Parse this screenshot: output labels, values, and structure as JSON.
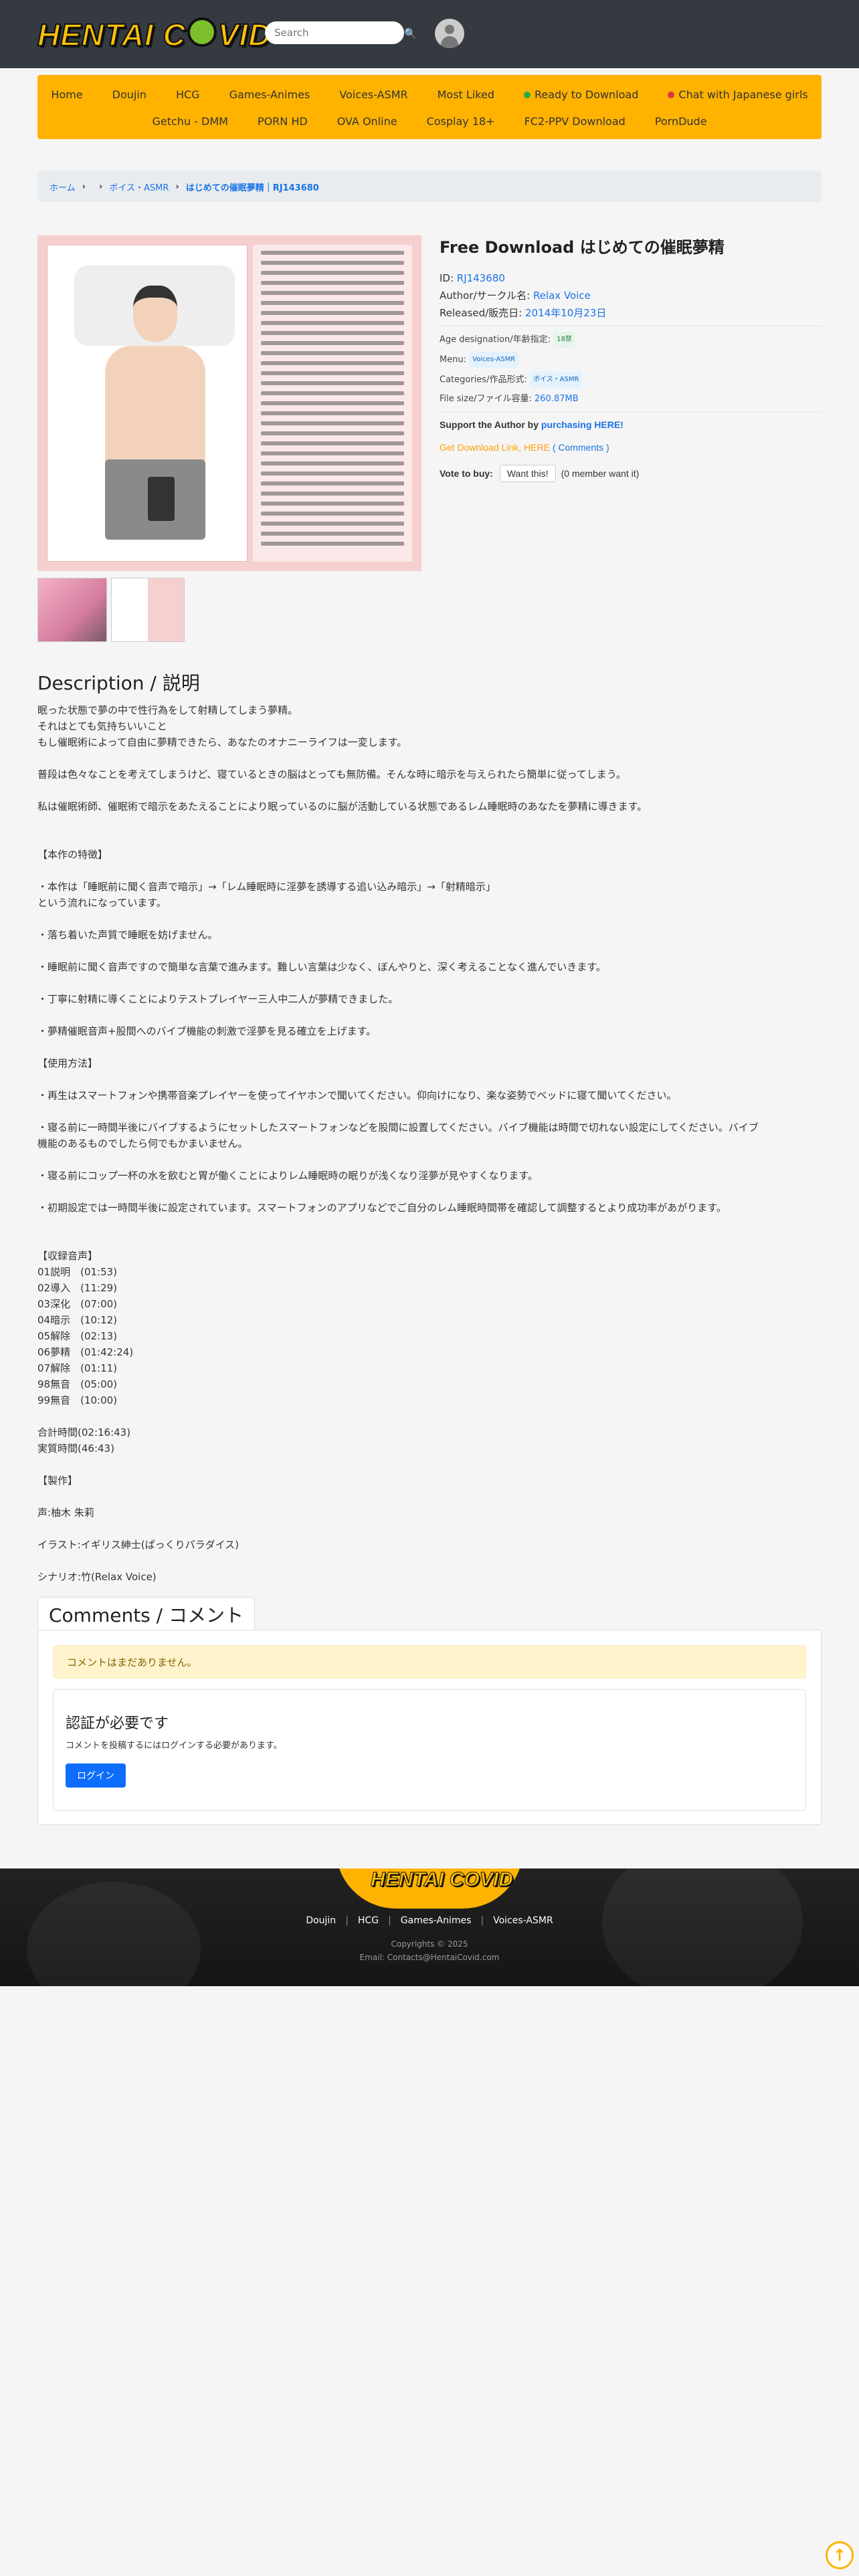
{
  "header": {
    "logo_text": "HENTAI C  VID",
    "search_placeholder": "Search"
  },
  "nav": {
    "row1": [
      "Home",
      "Doujin",
      "HCG",
      "Games-Animes",
      "Voices-ASMR",
      "Most Liked",
      "Ready to Download",
      "Chat with Japanese girls"
    ],
    "row2": [
      "Getchu - DMM",
      "PORN HD",
      "OVA Online",
      "Cosplay 18+",
      "FC2-PPV Download",
      "PornDude"
    ]
  },
  "breadcrumb": {
    "home": "ホーム",
    "category": "ボイス・ASMR",
    "current": "はじめての催眠夢精｜RJ143680"
  },
  "product": {
    "title": "Free Download はじめての催眠夢精",
    "id_label": "ID: ",
    "id_value": "RJ143680",
    "author_label": "Author/サークル名: ",
    "author_value": "Relax Voice",
    "released_label": "Released/販売日: ",
    "released_value": "2014年10月23日",
    "age_label": "Age designation/年齢指定: ",
    "age_value": "18禁",
    "menu_label": "Menu: ",
    "menu_value": "Voices-ASMR",
    "categories_label": "Categories/作品形式: ",
    "categories_value": "ボイス・ASMR",
    "filesize_label": "File size/ファイル容量: ",
    "filesize_value": "260.87MB",
    "support_text": "Support the Author by ",
    "support_link": "purchasing HERE!",
    "download_text": "Get Download Link, HERE",
    "comments_link": "( Comments )",
    "vote_label": "Vote to buy:",
    "vote_button": "Want this!",
    "vote_count": "(0 member want it)"
  },
  "description": {
    "heading": "Description / 説明",
    "lines": [
      "眠った状態で夢の中で性行為をして射精してしまう夢精。",
      "それはとても気持ちいいこと",
      "もし催眠術によって自由に夢精できたら、あなたのオナニーライフは一変します。",
      "",
      "普段は色々なことを考えてしまうけど、寝ているときの脳はとっても無防備。そんな時に暗示を与えられたら簡単に従ってしまう。",
      "",
      "私は催眠術師、催眠術で暗示をあたえることにより眠っているのに脳が活動している状態であるレム睡眠時のあなたを夢精に導きます。",
      "",
      "",
      "【本作の特徴】",
      "",
      "・本作は「睡眠前に聞く音声で暗示」→「レム睡眠時に淫夢を誘導する追い込み暗示」→「射精暗示」",
      "という流れになっています。",
      "",
      "・落ち着いた声質で睡眠を妨げません。",
      "",
      "・睡眠前に聞く音声ですので簡単な言葉で進みます。難しい言葉は少なく、ぼんやりと、深く考えることなく進んでいきます。",
      "",
      "・丁寧に射精に導くことによりテストプレイヤー三人中二人が夢精できました。",
      "",
      "・夢精催眠音声+股間へのバイブ機能の刺激で淫夢を見る確立を上げます。",
      "",
      "【使用方法】",
      "",
      "・再生はスマートフォンや携帯音楽プレイヤーを使ってイヤホンで聞いてください。仰向けになり、楽な姿勢でベッドに寝て聞いてください。",
      "",
      "・寝る前に一時間半後にバイブするようにセットしたスマートフォンなどを股間に設置してください。バイブ機能は時間で切れない設定にしてください。バイブ",
      "機能のあるものでしたら何でもかまいません。",
      "",
      "・寝る前にコップ一杯の水を飲むと胃が働くことによりレム睡眠時の眠りが浅くなり淫夢が見やすくなります。",
      "",
      "・初期設定では一時間半後に設定されています。スマートフォンのアプリなどでご自分のレム睡眠時間帯を確認して調整するとより成功率があがります。",
      "",
      "",
      "【収録音声】",
      "01説明　(01:53)",
      "02導入　(11:29)",
      "03深化　(07:00)",
      "04暗示　(10:12)",
      "05解除　(02:13)",
      "06夢精　(01:42:24)",
      "07解除　(01:11)",
      "98無音　(05:00)",
      "99無音　(10:00)",
      "",
      "合計時間(02:16:43)",
      "実質時間(46:43)",
      "",
      "【製作】",
      "",
      "声:柚木 朱莉",
      "",
      "イラスト:イギリス紳士(ぱっくりパラダイス)",
      "",
      "シナリオ:竹(Relax Voice)"
    ]
  },
  "comments": {
    "tab_label": "Comments / コメント",
    "empty_notice": "コメントはまだありません。",
    "auth_title": "認証が必要です",
    "auth_text": "コメントを投稿するにはログインする必要があります。",
    "login_button": "ログイン"
  },
  "footer": {
    "logo_text": "HENTAI COVID",
    "links": [
      "Doujin",
      "HCG",
      "Games-Animes",
      "Voices-ASMR"
    ],
    "copyright": "Copyrights © 2025",
    "email": "Email: Contacts@HentaiCovid.com"
  },
  "colors": {
    "header_bg": "#343a40",
    "nav_bg": "#ffb300",
    "link": "#1a73e8",
    "download": "#ffa000"
  },
  "icons": {
    "search": "search-icon",
    "user": "user-icon",
    "to_top": "arrow-up-icon"
  }
}
